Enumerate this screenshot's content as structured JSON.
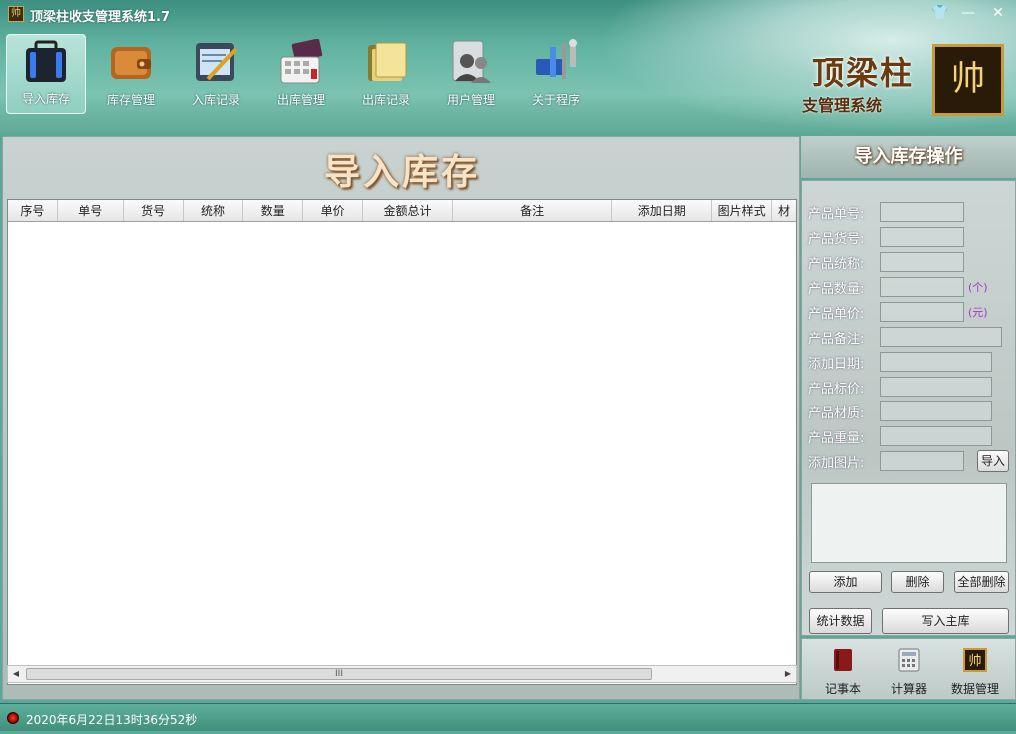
{
  "window": {
    "title": "顶梁柱收支管理系统1.7",
    "app_icon_glyph": "帅",
    "controls": {
      "skin": "👕",
      "minimize": "—",
      "close": "✕"
    }
  },
  "toolbar": [
    {
      "label": "导入库存",
      "icon": "suitcase-icon",
      "active": true
    },
    {
      "label": "库存管理",
      "icon": "wallet-icon",
      "active": false
    },
    {
      "label": "入库记录",
      "icon": "notepad-pencil-icon",
      "active": false
    },
    {
      "label": "出库管理",
      "icon": "card-keypad-icon",
      "active": false
    },
    {
      "label": "出库记录",
      "icon": "folder-icon",
      "active": false
    },
    {
      "label": "用户管理",
      "icon": "users-icon",
      "active": false
    },
    {
      "label": "关于程序",
      "icon": "tools-icon",
      "active": false
    }
  ],
  "brand": {
    "name": "顶梁柱",
    "subtitle": "支管理系统",
    "seal": "帅"
  },
  "main": {
    "title": "导入库存",
    "columns": [
      "序号",
      "单号",
      "货号",
      "统称",
      "数量",
      "单价",
      "金额总计",
      "备注",
      "添加日期",
      "图片样式",
      "材"
    ],
    "scroll_thumb": "III"
  },
  "side": {
    "title": "导入库存操作",
    "fields": [
      {
        "label": "产品单号:",
        "unit": ""
      },
      {
        "label": "产品货号:",
        "unit": ""
      },
      {
        "label": "产品统称:",
        "unit": ""
      },
      {
        "label": "产品数量:",
        "unit": "(个)"
      },
      {
        "label": "产品单价:",
        "unit": "(元)"
      },
      {
        "label": "产品备注:",
        "unit": ""
      },
      {
        "label": "添加日期:",
        "unit": ""
      },
      {
        "label": "产品标价:",
        "unit": ""
      },
      {
        "label": "产品材质:",
        "unit": ""
      },
      {
        "label": "产品重量:",
        "unit": ""
      },
      {
        "label": "添加图片:",
        "unit": ""
      }
    ],
    "import_button": "导入",
    "add_button": "添加",
    "delete_button": "删除",
    "delete_all_button": "全部删除",
    "stats_button": "统计数据",
    "write_button": "写入主库"
  },
  "shortcuts": [
    {
      "label": "记事本",
      "icon": "notebook-icon"
    },
    {
      "label": "计算器",
      "icon": "calculator-icon"
    },
    {
      "label": "数据管理",
      "icon": "seal-icon"
    }
  ],
  "status": {
    "datetime": "2020年6月22日13时36分52秒"
  },
  "colors": {
    "accent": "#5aa89a",
    "title_text": "#f6e4c8",
    "unit": "#a23cc8"
  }
}
